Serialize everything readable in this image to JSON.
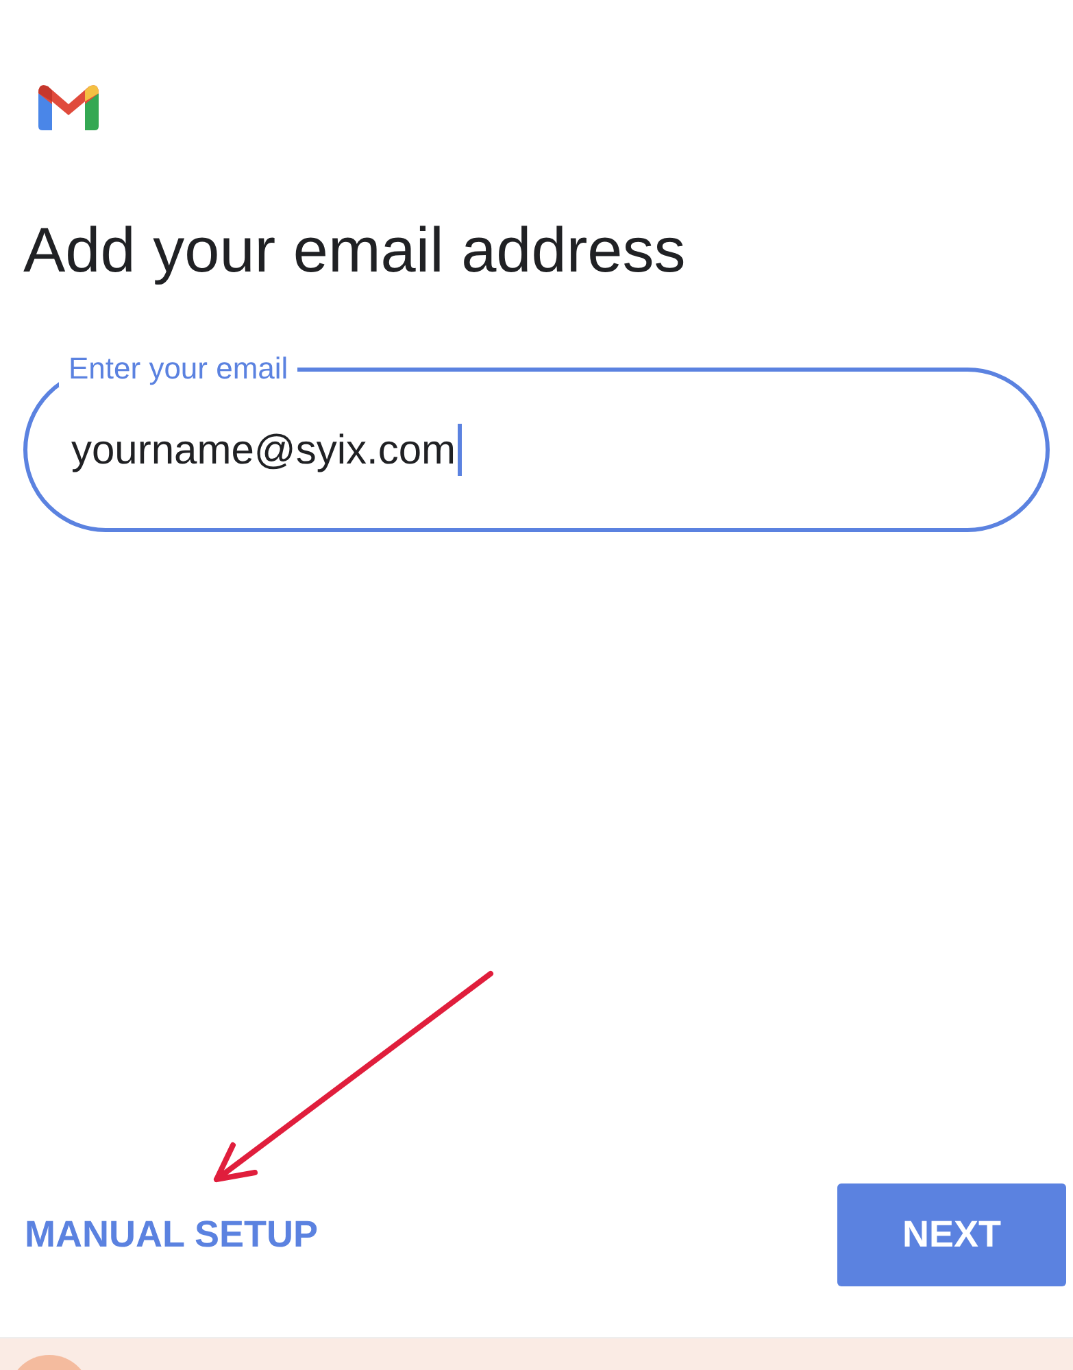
{
  "title": "Add your email address",
  "email_field": {
    "label": "Enter your email",
    "value": "yourname@syix.com",
    "focused": true
  },
  "buttons": [
    {
      "kind": "text",
      "label": "MANUAL SETUP"
    },
    {
      "kind": "filled",
      "label": "NEXT"
    }
  ]
}
